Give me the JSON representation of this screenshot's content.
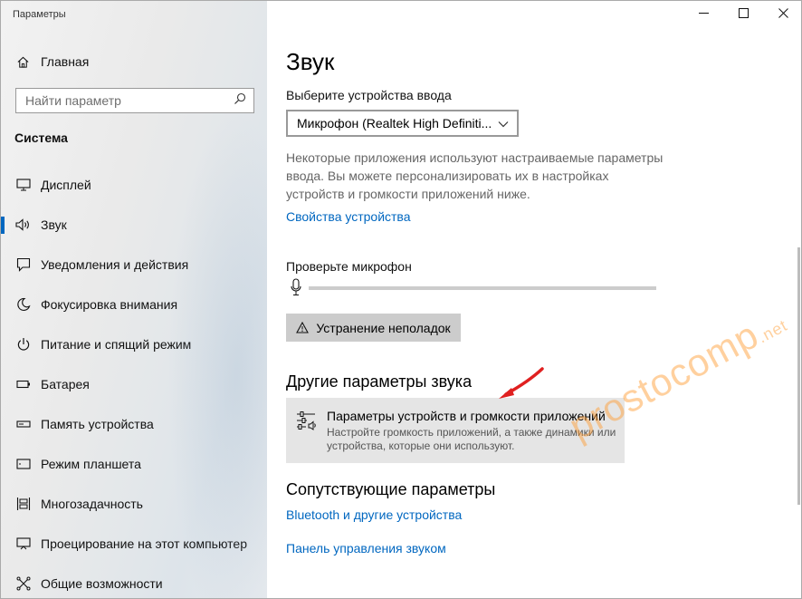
{
  "window": {
    "title": "Параметры"
  },
  "titlebar": {
    "minimize_icon": "minimize-icon",
    "maximize_icon": "maximize-icon",
    "close_icon": "close-icon"
  },
  "sidebar": {
    "home_label": "Главная",
    "search_placeholder": "Найти параметр",
    "section_title": "Система",
    "items": [
      {
        "label": "Дисплей",
        "icon": "monitor-icon"
      },
      {
        "label": "Звук",
        "icon": "speaker-icon",
        "active": true
      },
      {
        "label": "Уведомления и действия",
        "icon": "notification-icon"
      },
      {
        "label": "Фокусировка внимания",
        "icon": "moon-icon"
      },
      {
        "label": "Питание и спящий режим",
        "icon": "power-icon"
      },
      {
        "label": "Батарея",
        "icon": "battery-icon"
      },
      {
        "label": "Память устройства",
        "icon": "storage-icon"
      },
      {
        "label": "Режим планшета",
        "icon": "tablet-icon"
      },
      {
        "label": "Многозадачность",
        "icon": "multitask-icon"
      },
      {
        "label": "Проецирование на этот компьютер",
        "icon": "project-icon"
      },
      {
        "label": "Общие возможности",
        "icon": "shared-icon"
      }
    ],
    "accent_color": "#0067c0"
  },
  "main": {
    "title": "Звук",
    "input_label": "Выберите устройства ввода",
    "input_device": "Микрофон (Realtek High Definiti...",
    "description": "Некоторые приложения используют настраиваемые параметры ввода. Вы можете персонализировать их в настройках устройств и громкости приложений ниже.",
    "device_props_link": "Свойства устройства",
    "test_mic_label": "Проверьте микрофон",
    "mic_level": 0,
    "troubleshoot_button": "Устранение неполадок",
    "other_params_title": "Другие параметры звука",
    "card": {
      "title": "Параметры устройств и громкости приложений",
      "subtitle": "Настройте громкость приложений, а также динамики или устройства, которые они используют."
    },
    "related_title": "Сопутствующие параметры",
    "related_links": [
      "Bluetooth и другие устройства",
      "Панель управления звуком"
    ]
  },
  "watermark": {
    "text": "prostocomp",
    "suffix": ".net"
  },
  "colors": {
    "link": "#0067c0",
    "watermark": "#ff9628",
    "arrow": "#e02020"
  }
}
